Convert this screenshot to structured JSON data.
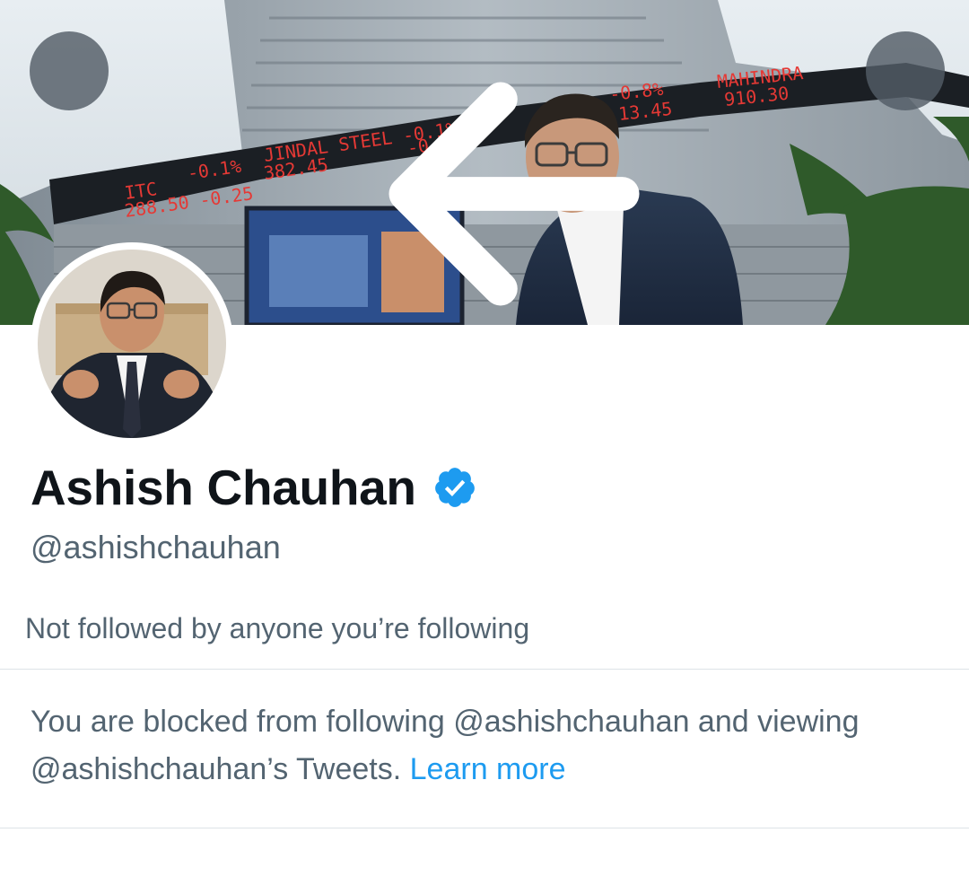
{
  "nav": {
    "back_icon": "arrow-left-icon",
    "more_icon": "more-vertical-icon"
  },
  "banner": {
    "ticker": [
      {
        "name": "ITC",
        "value": "288.50",
        "pct": "-0.1%",
        "change": "-0.25"
      },
      {
        "name": "JINDAL STEEL",
        "value": "382.45",
        "pct": "-0.1%",
        "change": "-0.40"
      },
      {
        "name": "",
        "value": "13.45",
        "pct": "-0.8%",
        "change": ""
      },
      {
        "name": "MAHINDRA",
        "value": "910.30",
        "pct": "",
        "change": ""
      }
    ]
  },
  "profile": {
    "display_name": "Ashish Chauhan",
    "verified_icon": "verified-badge-icon",
    "handle": "@ashishchauhan",
    "followers_note": "Not followed by anyone you’re following"
  },
  "blocked": {
    "message": "You are blocked from following @ashishchauhan and viewing @ashishchauhan’s Tweets.",
    "learn_more": "Learn more"
  },
  "colors": {
    "link": "#1d9bf0",
    "verified": "#1d9bf0",
    "primary_text": "#0f1419",
    "secondary_text": "#536471",
    "divider": "#dde3e7"
  }
}
